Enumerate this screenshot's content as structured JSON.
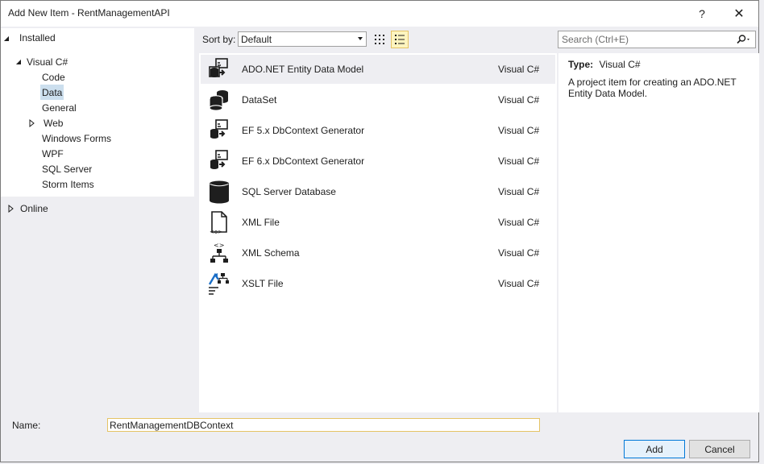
{
  "window": {
    "title": "Add New Item - RentManagementAPI",
    "help_label": "?",
    "close_label": "✕"
  },
  "tree": {
    "installed_label": "Installed",
    "visual_csharp_label": "Visual C#",
    "children": [
      "Code",
      "Data",
      "General",
      "Web",
      "Windows Forms",
      "WPF",
      "SQL Server",
      "Storm Items"
    ],
    "selected": "Data",
    "online_label": "Online"
  },
  "toolbar": {
    "sort_label": "Sort by:",
    "sort_value": "Default",
    "search_placeholder": "Search (Ctrl+E)",
    "view_mode": "list"
  },
  "items": [
    {
      "name": "ADO.NET Entity Data Model",
      "type": "Visual C#",
      "icon": "entity-model-icon",
      "selected": true
    },
    {
      "name": "DataSet",
      "type": "Visual C#",
      "icon": "dataset-icon",
      "selected": false
    },
    {
      "name": "EF 5.x DbContext Generator",
      "type": "Visual C#",
      "icon": "dbcontext-generator-icon",
      "selected": false
    },
    {
      "name": "EF 6.x DbContext Generator",
      "type": "Visual C#",
      "icon": "dbcontext-generator-icon",
      "selected": false
    },
    {
      "name": "SQL Server Database",
      "type": "Visual C#",
      "icon": "database-icon",
      "selected": false
    },
    {
      "name": "XML File",
      "type": "Visual C#",
      "icon": "xml-file-icon",
      "selected": false
    },
    {
      "name": "XML Schema",
      "type": "Visual C#",
      "icon": "xml-schema-icon",
      "selected": false
    },
    {
      "name": "XSLT File",
      "type": "Visual C#",
      "icon": "xslt-file-icon",
      "selected": false
    }
  ],
  "info": {
    "type_label": "Type:",
    "type_value": "Visual C#",
    "description": "A project item for creating an ADO.NET Entity Data Model."
  },
  "footer": {
    "name_label": "Name:",
    "name_value": "RentManagementDBContext",
    "add_label": "Add",
    "cancel_label": "Cancel"
  },
  "colors": {
    "accent": "#0078d7",
    "selection": "#ccdfee",
    "focus_border": "#e5c365"
  }
}
